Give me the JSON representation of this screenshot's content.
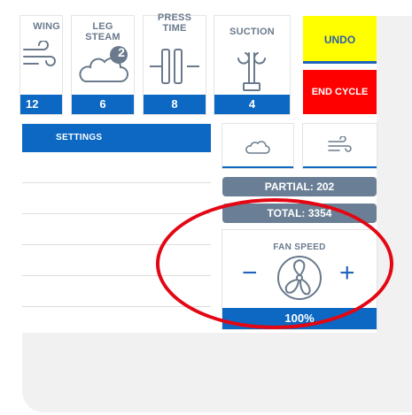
{
  "tiles": [
    {
      "label": "WING",
      "value": "12",
      "icon": "wind-icon"
    },
    {
      "label_line1": "LEG",
      "label_line2": "STEAM",
      "badge": "2",
      "value": "6",
      "icon": "cloud-icon"
    },
    {
      "label_line1": "PRESS",
      "label_line2": "TIME",
      "value": "8",
      "icon": "press-icon"
    },
    {
      "label": "SUCTION",
      "value": "4",
      "icon": "suction-icon"
    }
  ],
  "buttons": {
    "undo": "UNDO",
    "end_cycle": "END CYCLE"
  },
  "settings": {
    "label": "SETTINGS"
  },
  "counters": {
    "partial": "PARTIAL: 202",
    "total": "TOTAL: 3354"
  },
  "fan": {
    "title": "FAN SPEED",
    "minus": "−",
    "plus": "+",
    "value": "100%"
  },
  "colors": {
    "blue": "#0c68c2",
    "yellow": "#ffff00",
    "red": "#ff0000",
    "slate": "#6a7f95",
    "annotation": "#e30613"
  }
}
